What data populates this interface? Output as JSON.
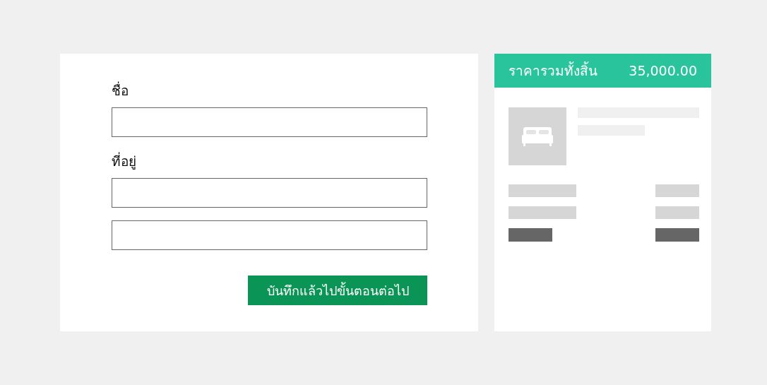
{
  "form": {
    "groups": [
      {
        "label": "ชื่อ",
        "kind": "single"
      },
      {
        "label": "ที่อยู่",
        "kind": "double"
      }
    ],
    "submit_button": "บันทึกแล้วไปขั้นตอนต่อไป"
  },
  "summary": {
    "total_label": "ราคารวมทั้งสิ้น",
    "total_value": "35,000.00"
  }
}
